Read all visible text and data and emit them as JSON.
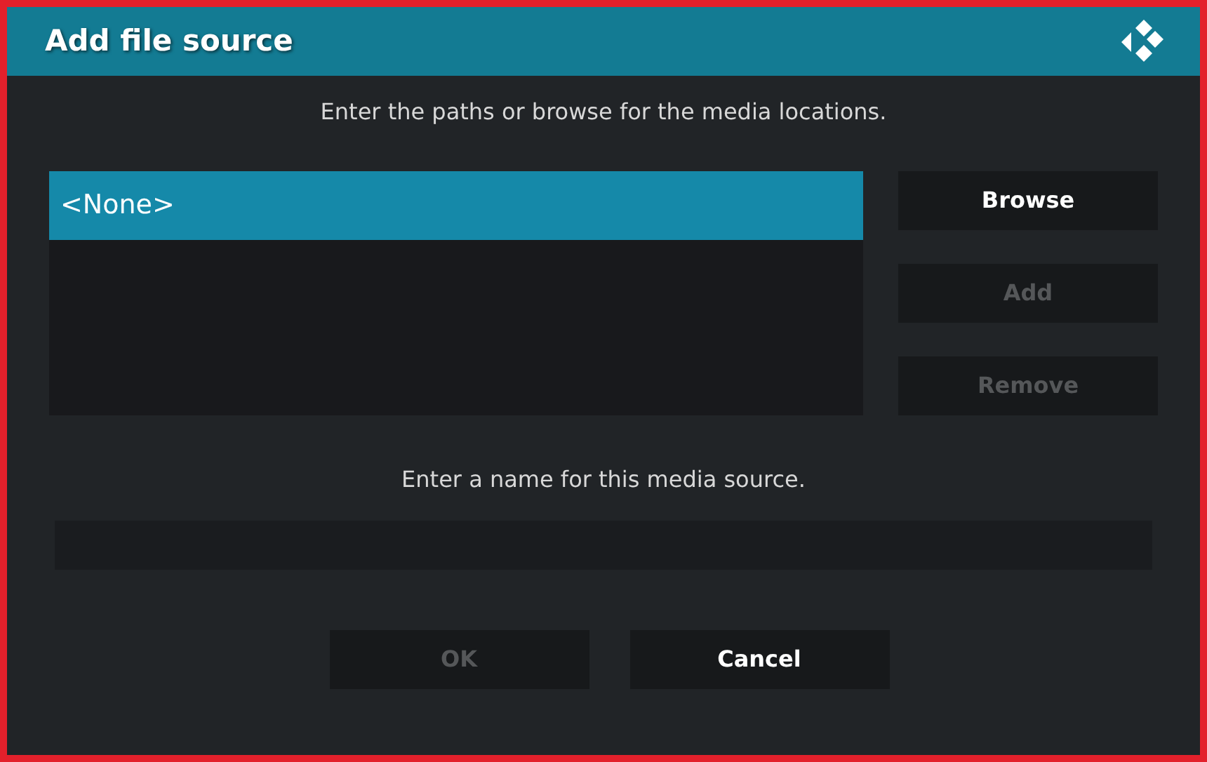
{
  "window": {
    "title": "Add file source"
  },
  "paths_label": "Enter the paths or browse for the media locations.",
  "paths": [
    {
      "text": "<None>",
      "selected": true
    }
  ],
  "side_buttons": [
    {
      "label": "Browse",
      "disabled": false
    },
    {
      "label": "Add",
      "disabled": true
    },
    {
      "label": "Remove",
      "disabled": true
    }
  ],
  "name_label": "Enter a name for this media source.",
  "buttons": [
    {
      "label": "OK",
      "disabled": true
    },
    {
      "label": "Cancel",
      "disabled": false
    }
  ]
}
